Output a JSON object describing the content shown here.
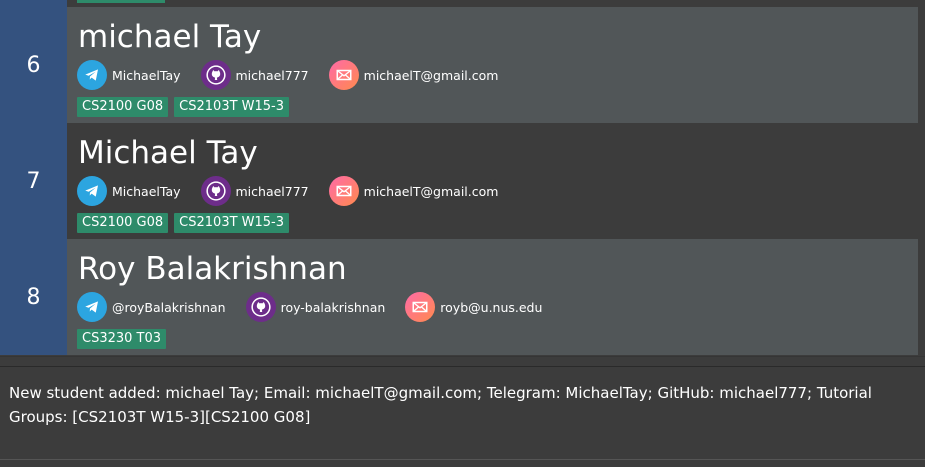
{
  "students": [
    {
      "index": "6",
      "name": "michael Tay",
      "telegram": "MichaelTay",
      "github": "michael777",
      "email": "michaelT@gmail.com",
      "tags": [
        "CS2100 G08",
        "CS2103T W15-3"
      ]
    },
    {
      "index": "7",
      "name": "Michael Tay",
      "telegram": "MichaelTay",
      "github": "michael777",
      "email": "michaelT@gmail.com",
      "tags": [
        "CS2100 G08",
        "CS2103T W15-3"
      ]
    },
    {
      "index": "8",
      "name": "Roy Balakrishnan",
      "telegram": "@royBalakrishnan",
      "github": "roy-balakrishnan",
      "email": "royb@u.nus.edu",
      "tags": [
        "CS3230 T03"
      ]
    }
  ],
  "icons": {
    "telegram": "telegram-icon",
    "github": "github-icon",
    "email": "email-icon"
  },
  "colors": {
    "index_bg": "#34527f",
    "tag_bg": "#2e8b6a",
    "card_even_bg": "#515658",
    "card_odd_bg": "#3c3c3c"
  },
  "result_display": {
    "text": "New student added: michael Tay; Email: michaelT@gmail.com; Telegram: MichaelTay; GitHub: michael777; Tutorial Groups: [CS2103T W15-3][CS2100 G08]"
  }
}
